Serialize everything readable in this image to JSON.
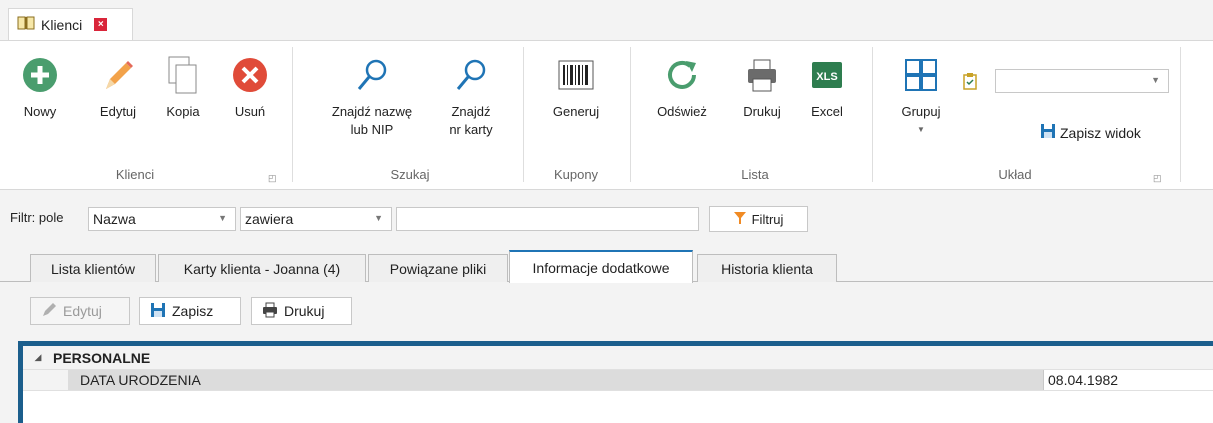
{
  "document_tab": {
    "title": "Klienci",
    "close": "×"
  },
  "ribbon": {
    "groups": {
      "klienci": {
        "label": "Klienci",
        "buttons": {
          "nowy": "Nowy",
          "edytuj": "Edytuj",
          "kopia": "Kopia",
          "usun": "Usuń"
        }
      },
      "szukaj": {
        "label": "Szukaj",
        "buttons": {
          "znajdz_nazwe_1": "Znajdź nazwę",
          "znajdz_nazwe_2": "lub NIP",
          "znajdz_nr_1": "Znajdź",
          "znajdz_nr_2": "nr karty"
        }
      },
      "kupony": {
        "label": "Kupony",
        "buttons": {
          "generuj": "Generuj"
        }
      },
      "lista": {
        "label": "Lista",
        "buttons": {
          "odswiez": "Odśwież",
          "drukuj": "Drukuj",
          "excel": "Excel"
        }
      },
      "uklad": {
        "label": "Układ",
        "buttons": {
          "grupuj": "Grupuj",
          "zapisz_widok": "Zapisz widok"
        },
        "layout_combo_value": ""
      }
    },
    "colors": {
      "accent_blue": "#1f74b5",
      "add_green": "#4a9d6e",
      "delete_red": "#e04b39"
    }
  },
  "filter": {
    "label": "Filtr: pole",
    "field_value": "Nazwa",
    "operator_value": "zawiera",
    "text_value": "",
    "button": "Filtruj"
  },
  "tabs": [
    {
      "label": "Lista klientów",
      "active": false
    },
    {
      "label": "Karty klienta - Joanna (4)",
      "active": false
    },
    {
      "label": "Powiązane pliki",
      "active": false
    },
    {
      "label": "Informacje dodatkowe",
      "active": true
    },
    {
      "label": "Historia klienta",
      "active": false
    }
  ],
  "toolbar": {
    "edit": "Edytuj",
    "save": "Zapisz",
    "print": "Drukuj"
  },
  "grid": {
    "section": "PERSONALNE",
    "rows": [
      {
        "name": "DATA URODZENIA",
        "value": "08.04.1982"
      }
    ]
  }
}
